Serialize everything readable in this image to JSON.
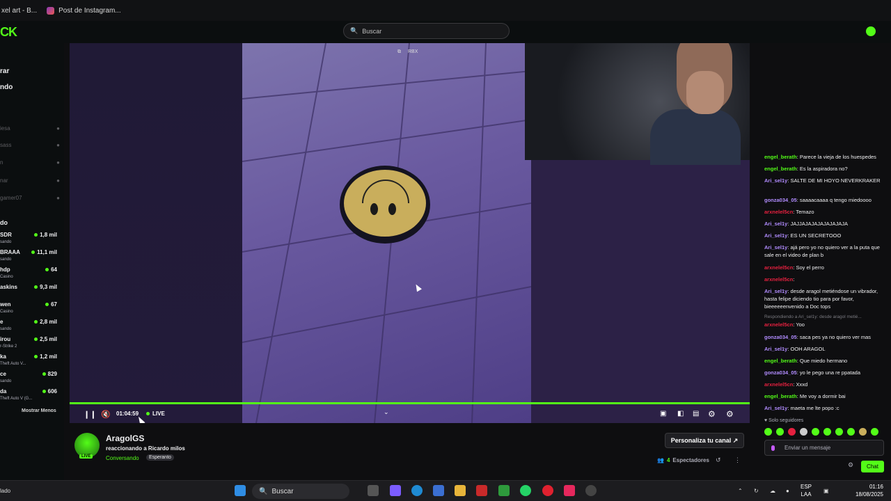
{
  "browser": {
    "tabs": [
      {
        "label": "xel art - B..."
      },
      {
        "label": "Post de Instagram..."
      }
    ]
  },
  "header": {
    "logo": "CK",
    "search_placeholder": "Buscar"
  },
  "sidebar": {
    "nav": [
      "rar",
      "ndo"
    ],
    "offline": [
      "iesa",
      "sass",
      "n",
      "nar",
      "gamer07"
    ],
    "section_title": "do",
    "channels": [
      {
        "name": "SDR",
        "category": "sando",
        "viewers": "1,8 mil"
      },
      {
        "name": "BRAAA",
        "category": "sando",
        "viewers": "11,1 mil"
      },
      {
        "name": "hdp",
        "category": "Casino",
        "viewers": "64"
      },
      {
        "name": "askins",
        "category": "",
        "viewers": "9,3 mil"
      },
      {
        "name": "wen",
        "category": "Casino",
        "viewers": "67"
      },
      {
        "name": "e",
        "category": "sando",
        "viewers": "2,8 mil"
      },
      {
        "name": "irou",
        "category": "r-Strike 2",
        "viewers": "2,5 mil"
      },
      {
        "name": "ka",
        "category": "Theft Auto V...",
        "viewers": "1,2 mil"
      },
      {
        "name": "ce",
        "category": "sando",
        "viewers": "829"
      },
      {
        "name": "da",
        "category": "Theft Auto V (G...",
        "viewers": "606"
      }
    ],
    "show_less": "Mostrar Menos"
  },
  "player": {
    "time": "01:04:59",
    "live_label": "LIVE",
    "pip_label": "RBX"
  },
  "stream": {
    "channel_name": "AragolGS",
    "title": "reaccionando a Ricardo milos",
    "category": "Conversando",
    "tag": "Esperanto",
    "live_badge": "LIVE",
    "personalize": "Personaliza tu canal",
    "viewers_count": "4",
    "viewers_label": "Espectadores"
  },
  "chat": {
    "messages": [
      {
        "user": "engel_berath",
        "color": "#53fc18",
        "text": ": Parece la vieja de los huespedes"
      },
      {
        "user": "engel_berath",
        "color": "#53fc18",
        "text": ": Es la aspiradora no?"
      },
      {
        "user": "Ari_sel1y",
        "color": "#b18cff",
        "text": ": SALTE DE MI HOYO NEVERKRAKER"
      },
      {
        "user": "gonza034_05",
        "color": "#b18cff",
        "text": ": saaaacaaaa q tengo miedoooo"
      },
      {
        "user": "arxnelel5cn",
        "color": "#e5203f",
        "text": ": Temazo"
      },
      {
        "user": "Ari_sel1y",
        "color": "#b18cff",
        "text": ": JAJJAJAJAJAJAJAJAJA"
      },
      {
        "user": "Ari_sel1y",
        "color": "#b18cff",
        "text": ": ES UN SECRETOOO"
      },
      {
        "user": "Ari_sel1y",
        "color": "#b18cff",
        "text": ": ajá pero yo no quiero ver a la puta que sale en el video de plan b"
      },
      {
        "user": "arxnelel5cn",
        "color": "#e5203f",
        "text": ": Soy el perro"
      },
      {
        "user": "arxnelel5cn",
        "color": "#e5203f",
        "text": ":"
      },
      {
        "user": "Ari_sel1y",
        "color": "#b18cff",
        "text": ": desde aragol metiéndose un vibrador, hasta felipe diciendo tio para por favor, bieeeeeenvenido a Doc tops"
      },
      {
        "user": "arxnelel5cn",
        "color": "#e5203f",
        "text": ": Yoo"
      },
      {
        "user": "gonza034_05",
        "color": "#b18cff",
        "text": ": saca pes ya no quiero ver mas"
      },
      {
        "user": "Ari_sel1y",
        "color": "#b18cff",
        "text": ": OOH ARAGOL"
      },
      {
        "user": "engel_berath",
        "color": "#53fc18",
        "text": ": Que miedo hermano"
      },
      {
        "user": "gonza034_05",
        "color": "#b18cff",
        "text": ": yo le pego una re ppatada"
      },
      {
        "user": "arxnelel5cn",
        "color": "#e5203f",
        "text": ": Xxxd"
      },
      {
        "user": "engel_berath",
        "color": "#53fc18",
        "text": ": Me voy a dormir bai"
      },
      {
        "user": "Ari_sel1y",
        "color": "#b18cff",
        "text": ": maeta me lte popo :c"
      }
    ],
    "reply_note": "Respondiendo a Ari_sel1y: desde aragol metié...",
    "followers_only": "Solo seguidores",
    "input_placeholder": "Enviar un mensaje",
    "send_label": "Chat"
  },
  "taskbar": {
    "left_text": "lado",
    "search": "Buscar",
    "lang_top": "ESP",
    "lang_bottom": "LAA",
    "time": "01:16",
    "date": "18/08/2025"
  }
}
